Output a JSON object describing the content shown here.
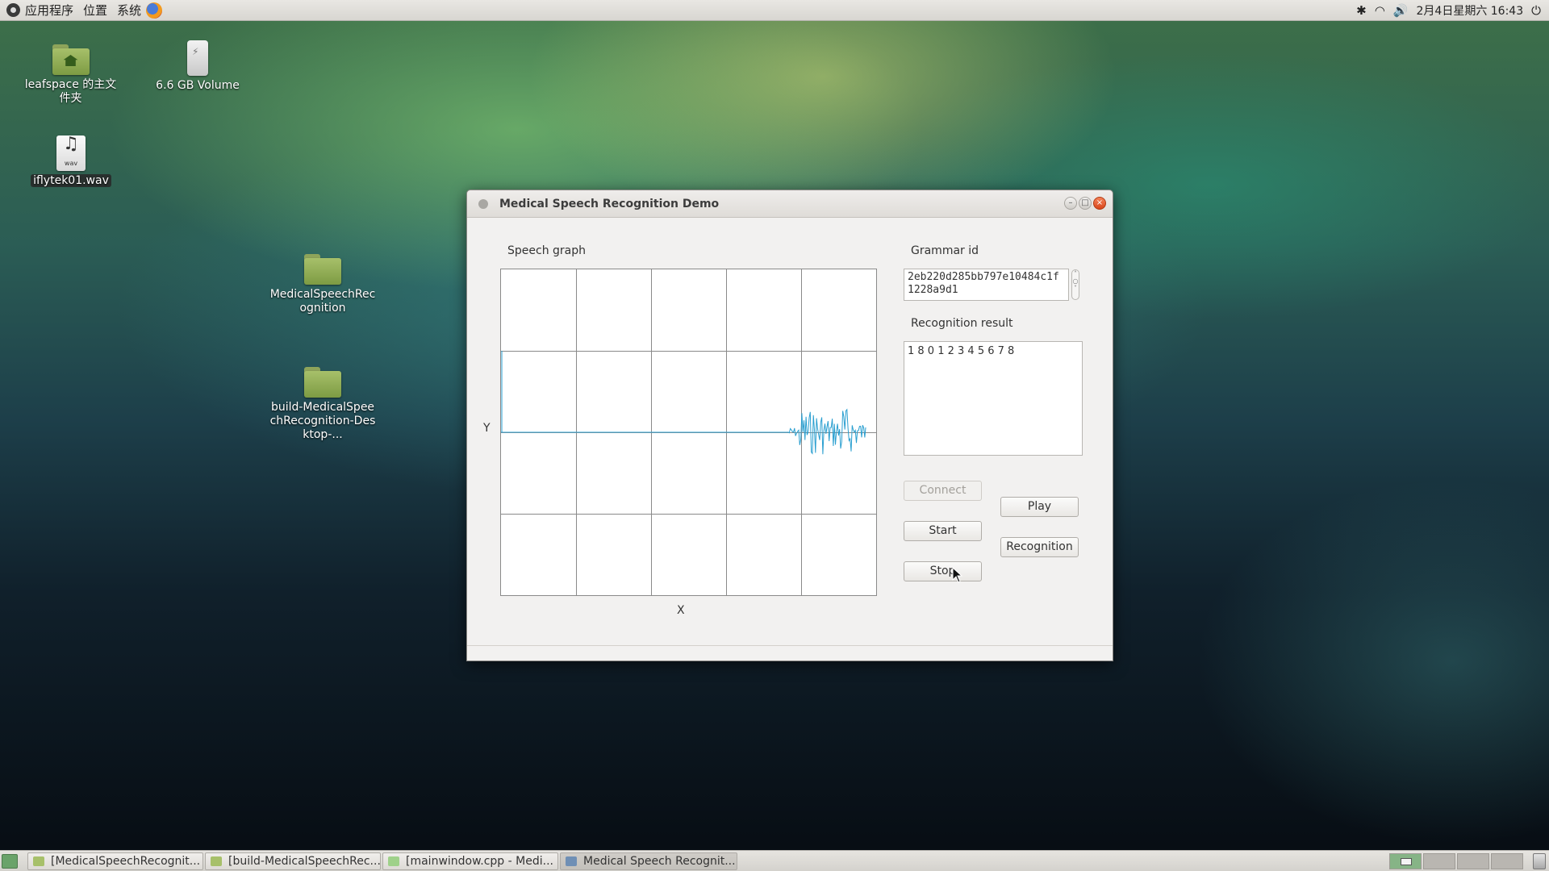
{
  "top_panel": {
    "menus": [
      "应用程序",
      "位置",
      "系统"
    ],
    "clock": "2月4日星期六 16:43"
  },
  "desktop": {
    "icons": [
      {
        "label": "leafspace 的主文件夹",
        "type": "home-folder"
      },
      {
        "label": "6.6 GB Volume",
        "type": "usb-drive"
      },
      {
        "label": "iflytek01.wav",
        "type": "audio-file",
        "file_ext": "wav"
      },
      {
        "label": "MedicalSpeechRecognition",
        "type": "folder"
      },
      {
        "label": "build-MedicalSpeechRecognition-Desktop-...",
        "type": "folder"
      }
    ]
  },
  "window": {
    "title": "Medical Speech Recognition Demo",
    "speech_graph_label": "Speech graph",
    "y_axis_label": "Y",
    "x_axis_label": "X",
    "grammar_id_label": "Grammar id",
    "grammar_id_value": "2eb220d285bb797e10484c1f1228a9d1",
    "recognition_result_label": "Recognition result",
    "recognition_result_value": "1 8 0 1 2 3 4 5 6 7 8",
    "buttons": {
      "connect": "Connect",
      "start": "Start",
      "stop": "Stop",
      "play": "Play",
      "recognition": "Recognition"
    },
    "connect_enabled": false,
    "waveform_color": "#2a9fd0"
  },
  "taskbar": {
    "tasks": [
      {
        "label": "[MedicalSpeechRecognit...",
        "icon": "folder-icon"
      },
      {
        "label": "[build-MedicalSpeechRec...",
        "icon": "folder-icon"
      },
      {
        "label": "[mainwindow.cpp - Medi...",
        "icon": "editor-icon"
      },
      {
        "label": "Medical Speech Recognit...",
        "icon": "window-icon",
        "active": true
      }
    ]
  }
}
